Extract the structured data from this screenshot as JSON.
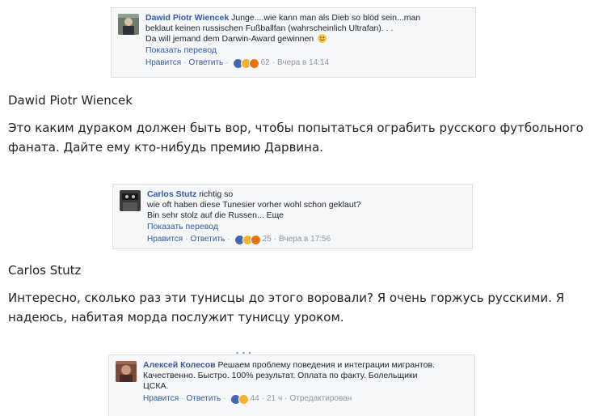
{
  "comments": [
    {
      "author": "Dawid Piotr Wiencek",
      "text_lines": [
        "Junge....wie kann man als Dieb so blöd sein...man",
        "beklaut keinen russischen Fußballfan (wahrscheinlich Ultrafan). . .",
        "Da will jemand dem Darwin-Award gewinnen"
      ],
      "translate": "Показать перевод",
      "like": "Нравится",
      "reply": "Ответить",
      "reactions": "62",
      "time": "Вчера в 14:14"
    },
    {
      "author": "Carlos Stutz",
      "text_lines": [
        "richtig so",
        "wie oft haben diese Tunesier vorher wohl schon geklaut?",
        "Bin sehr stolz auf die Russen... Еще"
      ],
      "translate": "Показать перевод",
      "like": "Нравится",
      "reply": "Ответить",
      "reactions": "25",
      "time": "Вчера в 17:56"
    },
    {
      "author": "Алексей Колесов",
      "text_lines": [
        "Решаем проблему поведения и интеграции мигрантов.",
        "Качественно. Быстро. 100% результат. Оплата по факту. Болельщики",
        "ЦСКА."
      ],
      "like": "Нравится",
      "reply": "Ответить",
      "reactions": "44",
      "time": "21 ч",
      "edited": "Отредактирован"
    }
  ],
  "captions": [
    {
      "name": "Dawid Piotr Wiencek",
      "text": "Это каким дураком должен быть вор, чтобы попытаться ограбить русского футбольного фаната. Дайте ему кто-нибудь премию Дарвина."
    },
    {
      "name": "Carlos Stutz",
      "text": "Интересно, сколько раз эти тунисцы до этого воровали? Я очень горжусь русскими. Я надеюсь, набитая морда послужит тунисцу уроком."
    }
  ],
  "colors": {
    "link": "#365899",
    "meta": "#90949c",
    "card_bg": "#f6f7f9",
    "like_reaction": "#4267b2",
    "haha_reaction": "#f7b125",
    "angry_reaction": "#e9710f"
  }
}
